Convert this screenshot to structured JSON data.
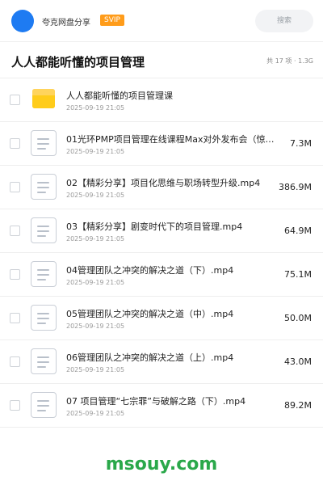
{
  "header": {
    "username": "夸克网盘分享",
    "badge": "SVIP",
    "search_placeholder": "搜索"
  },
  "folder": {
    "title": "人人都能听懂的项目管理",
    "summary": "共 17 项 · 1.3G"
  },
  "files": [
    {
      "name": "人人都能听懂的项目管理课",
      "date": "2025-09-19 21:05",
      "size": "",
      "type": "folder"
    },
    {
      "name": "01光环PMP项目管理在线课程Max对外发布会（惊…",
      "date": "2025-09-19 21:05",
      "size": "7.3M",
      "type": "doc"
    },
    {
      "name": "02【精彩分享】项目化思维与职场转型升级.mp4",
      "date": "2025-09-19 21:05",
      "size": "386.9M",
      "type": "doc"
    },
    {
      "name": "03【精彩分享】剧变时代下的项目管理.mp4",
      "date": "2025-09-19 21:05",
      "size": "64.9M",
      "type": "doc"
    },
    {
      "name": "04管理团队之冲突的解决之道（下）.mp4",
      "date": "2025-09-19 21:05",
      "size": "75.1M",
      "type": "doc"
    },
    {
      "name": "05管理团队之冲突的解决之道（中）.mp4",
      "date": "2025-09-19 21:05",
      "size": "50.0M",
      "type": "doc"
    },
    {
      "name": "06管理团队之冲突的解决之道（上）.mp4",
      "date": "2025-09-19 21:05",
      "size": "43.0M",
      "type": "doc"
    },
    {
      "name": "07 项目管理“七宗罪”与破解之路（下）.mp4",
      "date": "2025-09-19 21:05",
      "size": "89.2M",
      "type": "doc"
    }
  ],
  "watermark": "msouy.com"
}
